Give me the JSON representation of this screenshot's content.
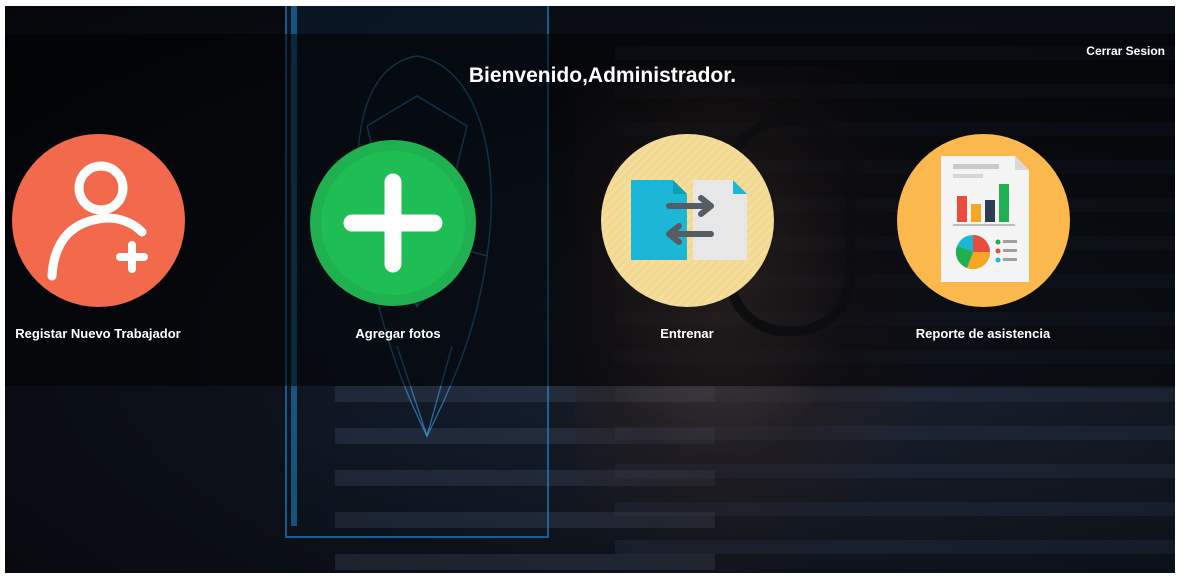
{
  "header": {
    "logout_label": "Cerrar Sesion",
    "welcome_title": "Bienvenido,Administrador."
  },
  "tiles": [
    {
      "label": "Registar Nuevo Trabajador",
      "icon": "add-user-icon",
      "color": "#f26a4b"
    },
    {
      "label": "Agregar fotos",
      "icon": "plus-icon",
      "color": "#1fb14f"
    },
    {
      "label": "Entrenar",
      "icon": "file-transfer-icon",
      "color": "#f3d890"
    },
    {
      "label": "Reporte de asistencia",
      "icon": "report-chart-icon",
      "color": "#fbb84d"
    }
  ]
}
